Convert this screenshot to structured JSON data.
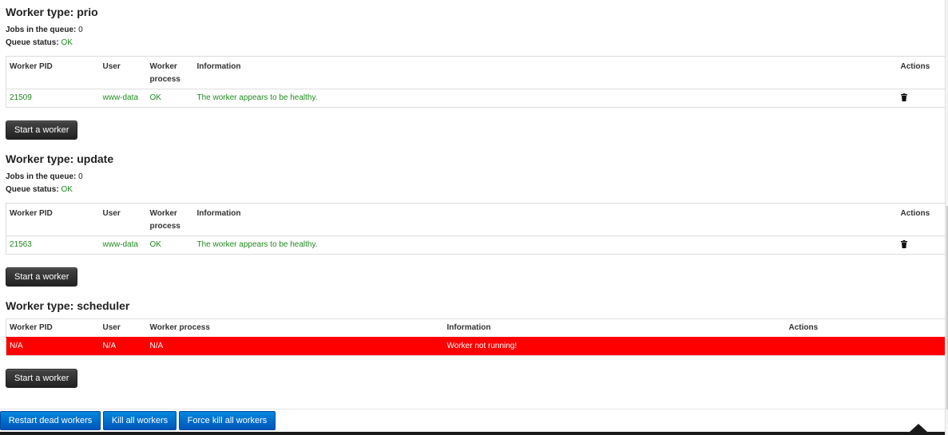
{
  "sections": [
    {
      "title": "Worker type: prio",
      "jobs_label": "Jobs in the queue:",
      "jobs_value": "0",
      "status_label": "Queue status:",
      "status_value": "OK",
      "headers": [
        "Worker PID",
        "User",
        "Worker process",
        "Information",
        "Actions"
      ],
      "rows": [
        {
          "pid": "21509",
          "user": "www-data",
          "process": "OK",
          "info": "The worker appears to be healthy.",
          "action_icon": "trash-icon"
        }
      ],
      "start_button": "Start a worker"
    },
    {
      "title": "Worker type: update",
      "jobs_label": "Jobs in the queue:",
      "jobs_value": "0",
      "status_label": "Queue status:",
      "status_value": "OK",
      "headers": [
        "Worker PID",
        "User",
        "Worker process",
        "Information",
        "Actions"
      ],
      "rows": [
        {
          "pid": "21563",
          "user": "www-data",
          "process": "OK",
          "info": "The worker appears to be healthy.",
          "action_icon": "trash-icon"
        }
      ],
      "start_button": "Start a worker"
    },
    {
      "title": "Worker type: scheduler",
      "headers": [
        "Worker PID",
        "User",
        "Worker process",
        "Information",
        "Actions"
      ],
      "rows": [
        {
          "pid": "N/A",
          "user": "N/A",
          "process": "N/A",
          "info": "Worker not running!",
          "action": ""
        }
      ],
      "start_button": "Start a worker"
    }
  ],
  "footer": {
    "restart_label": "Restart dead workers",
    "kill_label": "Kill all workers",
    "force_kill_label": "Force kill all workers"
  },
  "colors": {
    "ok_text": "#228b22",
    "dead_row_bg": "#ff0000",
    "primary_button": "#0066cc",
    "dark_button": "#333333"
  }
}
